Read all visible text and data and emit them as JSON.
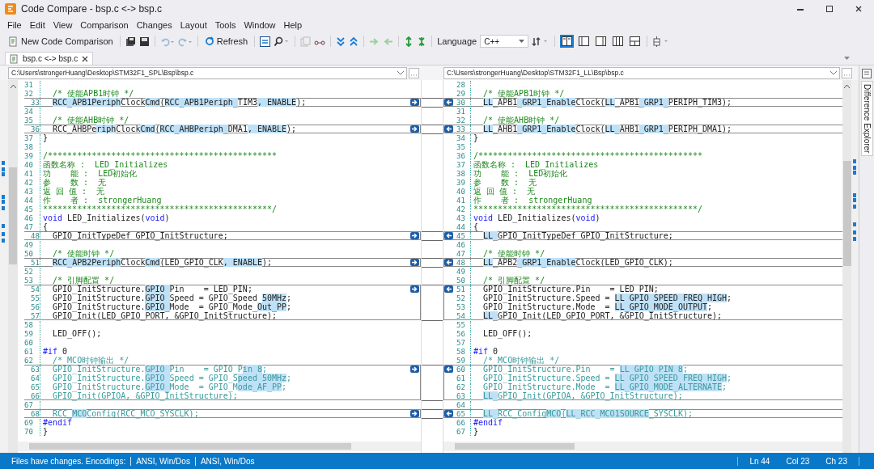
{
  "window": {
    "title": "Code Compare - bsp.c <-> bsp.c"
  },
  "menu": [
    "File",
    "Edit",
    "View",
    "Comparison",
    "Changes",
    "Layout",
    "Tools",
    "Window",
    "Help"
  ],
  "toolbar": {
    "new_comparison": "New Code Comparison",
    "refresh": "Refresh",
    "language_label": "Language",
    "language": "C++",
    "view_modes": [
      {
        "selected": true
      },
      {
        "selected": false
      },
      {
        "selected": false
      },
      {
        "selected": false
      },
      {
        "selected": false
      }
    ]
  },
  "tabs": [
    {
      "label": "bsp.c <-> bsp.c",
      "selected": true
    }
  ],
  "side_tab": "Difference Explorer",
  "left": {
    "path": "C:\\Users\\strongerHuang\\Desktop\\STM32F1_SPL\\Bsp\\bsp.c",
    "lines": [
      {
        "number": "31",
        "kind": "code",
        "changed": false,
        "arrow": false
      },
      {
        "number": "32",
        "kind": "comment",
        "changed": false,
        "arrow": false,
        "text": "  /* 使能APB1时钟 */"
      },
      {
        "number": "33",
        "kind": "code",
        "changed": true,
        "arrow": true,
        "segments": [
          {
            "text": "  RCC_APB1Periph",
            "changed": true
          },
          {
            "text": "Clock"
          },
          {
            "text": "Cmd",
            "changed": true
          },
          {
            "text": "("
          },
          {
            "text": "RCC_APB1Periph_",
            "changed": true
          },
          {
            "text": "TIM3"
          },
          {
            "text": ", ENABLE",
            "changed": true
          },
          {
            "text": ");"
          }
        ]
      },
      {
        "number": "34",
        "kind": "code",
        "changed": false,
        "arrow": false
      },
      {
        "number": "35",
        "kind": "comment",
        "changed": false,
        "arrow": false,
        "text": "  /* 使能AHB时钟 */"
      },
      {
        "number": "36",
        "kind": "code",
        "changed": true,
        "arrow": true,
        "segments": [
          {
            "text": "  RCC_AHBPe"
          },
          {
            "text": "riph",
            "changed": true
          },
          {
            "text": "Clock"
          },
          {
            "text": "Cmd",
            "changed": true
          },
          {
            "text": "("
          },
          {
            "text": "RCC_AHBPeriph_",
            "changed": true
          },
          {
            "text": "DMA1"
          },
          {
            "text": ", ENABLE",
            "changed": true
          },
          {
            "text": ");"
          }
        ]
      },
      {
        "number": "37",
        "kind": "code",
        "changed": false,
        "arrow": false,
        "text": "}"
      },
      {
        "number": "38",
        "kind": "code",
        "changed": false,
        "arrow": false
      },
      {
        "number": "39",
        "kind": "comment",
        "changed": false,
        "arrow": false,
        "text": "/***********************************************"
      },
      {
        "number": "40",
        "kind": "comment",
        "changed": false,
        "arrow": false,
        "text": "函数名称 :  LED_Initializes"
      },
      {
        "number": "41",
        "kind": "comment",
        "changed": false,
        "arrow": false,
        "text": "功    能 :  LED初始化"
      },
      {
        "number": "42",
        "kind": "comment",
        "changed": false,
        "arrow": false,
        "text": "参    数 :  无"
      },
      {
        "number": "43",
        "kind": "comment",
        "changed": false,
        "arrow": false,
        "text": "返 回 值 :  无"
      },
      {
        "number": "44",
        "kind": "comment",
        "changed": false,
        "arrow": false,
        "text": "作    者 :  strongerHuang"
      },
      {
        "number": "45",
        "kind": "comment",
        "changed": false,
        "arrow": false,
        "text": "***********************************************/"
      },
      {
        "number": "46",
        "kind": "code",
        "changed": false,
        "arrow": false,
        "segments": [
          {
            "text": "void",
            "kind": "keyword"
          },
          {
            "text": " LED_Initializes("
          },
          {
            "text": "void",
            "kind": "keyword"
          },
          {
            "text": ")"
          }
        ]
      },
      {
        "number": "47",
        "kind": "code",
        "changed": false,
        "arrow": false,
        "text": "{"
      },
      {
        "number": "48",
        "kind": "code",
        "changed": true,
        "arrow": true,
        "text": "  GPIO_InitTypeDef GPIO_InitStructure;"
      },
      {
        "number": "49",
        "kind": "code",
        "changed": false,
        "arrow": false
      },
      {
        "number": "50",
        "kind": "comment",
        "changed": false,
        "arrow": false,
        "text": "  /* 使能时钟 */"
      },
      {
        "number": "51",
        "kind": "code",
        "changed": true,
        "arrow": true,
        "segments": [
          {
            "text": "  RCC_APB2Periph",
            "changed": true
          },
          {
            "text": "Clock"
          },
          {
            "text": "Cmd",
            "changed": true
          },
          {
            "text": "(LED_GPIO_CLK"
          },
          {
            "text": ", ENABLE",
            "changed": true
          },
          {
            "text": ");"
          }
        ]
      },
      {
        "number": "52",
        "kind": "code",
        "changed": false,
        "arrow": false
      },
      {
        "number": "53",
        "kind": "comment",
        "changed": false,
        "arrow": false,
        "text": "  /* 引脚配置 */"
      },
      {
        "number": "54",
        "kind": "code",
        "changed": true,
        "arrow": true,
        "segments": [
          {
            "text": "  GPIO_InitStructure."
          },
          {
            "text": "GPIO_",
            "changed": true
          },
          {
            "text": "Pin    = LED_PIN;"
          }
        ]
      },
      {
        "number": "55",
        "kind": "code",
        "changed": true,
        "arrow": false,
        "segments": [
          {
            "text": "  GPIO_InitStructure."
          },
          {
            "text": "GPIO_",
            "changed": true
          },
          {
            "text": "Speed = GPIO_Speed_"
          },
          {
            "text": "50MHz",
            "changed": true
          },
          {
            "text": ";"
          }
        ]
      },
      {
        "number": "56",
        "kind": "code",
        "changed": true,
        "arrow": false,
        "segments": [
          {
            "text": "  GPIO_InitStructure."
          },
          {
            "text": "GPIO_",
            "changed": true
          },
          {
            "text": "Mode  = GPIO_Mode_"
          },
          {
            "text": "Out_PP",
            "changed": true
          },
          {
            "text": ";"
          }
        ]
      },
      {
        "number": "57",
        "kind": "code",
        "changed": true,
        "arrow": false,
        "text": "  GPIO_Init(LED_GPIO_PORT, &GPIO_InitStructure);"
      },
      {
        "number": "58",
        "kind": "code",
        "changed": false,
        "arrow": false
      },
      {
        "number": "59",
        "kind": "code",
        "changed": false,
        "arrow": false,
        "text": "  LED_OFF();"
      },
      {
        "number": "60",
        "kind": "code",
        "changed": false,
        "arrow": false
      },
      {
        "number": "61",
        "kind": "code",
        "changed": false,
        "arrow": false,
        "segments": [
          {
            "text": "#if",
            "kind": "keyword"
          },
          {
            "text": " 0"
          }
        ]
      },
      {
        "number": "62",
        "kind": "inactive",
        "changed": false,
        "arrow": false,
        "text": "  /* MCO时钟输出 */"
      },
      {
        "number": "63",
        "kind": "inactive",
        "changed": true,
        "arrow": true,
        "segments": [
          {
            "text": "  GPIO_InitStructure."
          },
          {
            "text": "GPIO_",
            "changed": true
          },
          {
            "text": "Pin    = GPIO_P"
          },
          {
            "text": "in_8",
            "changed": true
          },
          {
            "text": ";"
          }
        ]
      },
      {
        "number": "64",
        "kind": "inactive",
        "changed": true,
        "arrow": false,
        "segments": [
          {
            "text": "  GPIO_InitStructure."
          },
          {
            "text": "GPIO_",
            "changed": true
          },
          {
            "text": "Speed = GPIO_S"
          },
          {
            "text": "peed_50MHz",
            "changed": true
          },
          {
            "text": ";"
          }
        ]
      },
      {
        "number": "65",
        "kind": "inactive",
        "changed": true,
        "arrow": false,
        "segments": [
          {
            "text": "  GPIO_InitStructure."
          },
          {
            "text": "GPIO_",
            "changed": true
          },
          {
            "text": "Mode  = GPIO_M"
          },
          {
            "text": "ode_AF_PP",
            "changed": true
          },
          {
            "text": ";"
          }
        ]
      },
      {
        "number": "66",
        "kind": "inactive",
        "changed": true,
        "arrow": false,
        "text": "  GPIO_Init(GPIOA, &GPIO_InitStructure);"
      },
      {
        "number": "67",
        "kind": "code",
        "changed": false,
        "arrow": false
      },
      {
        "number": "68",
        "kind": "inactive",
        "changed": true,
        "arrow": true,
        "segments": [
          {
            "text": "  RCC_"
          },
          {
            "text": "MCO",
            "changed": true
          },
          {
            "text": "Config(RCC_MCO_SYSCLK);"
          }
        ]
      },
      {
        "number": "69",
        "kind": "code",
        "changed": false,
        "arrow": false,
        "segments": [
          {
            "text": "#endif",
            "kind": "keyword"
          }
        ]
      },
      {
        "number": "70",
        "kind": "code",
        "changed": false,
        "arrow": false,
        "text": "}"
      }
    ]
  },
  "right": {
    "path": "C:\\Users\\strongerHuang\\Desktop\\STM32F1_LL\\Bsp\\bsp.c",
    "lines": [
      {
        "number": "28",
        "kind": "code",
        "changed": false,
        "arrow": false
      },
      {
        "number": "29",
        "kind": "comment",
        "changed": false,
        "arrow": false,
        "text": "  /* 使能APB1时钟 */"
      },
      {
        "number": "30",
        "kind": "code",
        "changed": true,
        "arrow": true,
        "segments": [
          {
            "text": "  LL",
            "changed": true
          },
          {
            "text": "_APB1"
          },
          {
            "text": "_GRP1_Enable",
            "changed": true
          },
          {
            "text": "Clock("
          },
          {
            "text": "LL",
            "changed": true
          },
          {
            "text": "_APB1"
          },
          {
            "text": "_GRP1_",
            "changed": true
          },
          {
            "text": "PERIPH_TIM3);"
          }
        ]
      },
      {
        "number": "31",
        "kind": "code",
        "changed": false,
        "arrow": false
      },
      {
        "number": "32",
        "kind": "comment",
        "changed": false,
        "arrow": false,
        "text": "  /* 使能AHB时钟 */"
      },
      {
        "number": "33",
        "kind": "code",
        "changed": true,
        "arrow": true,
        "segments": [
          {
            "text": "  LL",
            "changed": true
          },
          {
            "text": "_AHB1"
          },
          {
            "text": "_GRP1_Enable",
            "changed": true
          },
          {
            "text": "Clock("
          },
          {
            "text": "LL_",
            "changed": true
          },
          {
            "text": "AHB1"
          },
          {
            "text": "_GRP1_",
            "changed": true
          },
          {
            "text": "PERIPH_DMA1);"
          }
        ]
      },
      {
        "number": "34",
        "kind": "code",
        "changed": false,
        "arrow": false,
        "text": "}"
      },
      {
        "number": "35",
        "kind": "code",
        "changed": false,
        "arrow": false
      },
      {
        "number": "36",
        "kind": "comment",
        "changed": false,
        "arrow": false,
        "text": "/**********************************************"
      },
      {
        "number": "37",
        "kind": "comment",
        "changed": false,
        "arrow": false,
        "text": "函数名称 :  LED_Initializes"
      },
      {
        "number": "38",
        "kind": "comment",
        "changed": false,
        "arrow": false,
        "text": "功    能 :  LED初始化"
      },
      {
        "number": "39",
        "kind": "comment",
        "changed": false,
        "arrow": false,
        "text": "参    数 :  无"
      },
      {
        "number": "40",
        "kind": "comment",
        "changed": false,
        "arrow": false,
        "text": "返 回 值 :  无"
      },
      {
        "number": "41",
        "kind": "comment",
        "changed": false,
        "arrow": false,
        "text": "作    者 :  strongerHuang"
      },
      {
        "number": "42",
        "kind": "comment",
        "changed": false,
        "arrow": false,
        "text": "**********************************************/"
      },
      {
        "number": "43",
        "kind": "code",
        "changed": false,
        "arrow": false,
        "segments": [
          {
            "text": "void",
            "kind": "keyword"
          },
          {
            "text": " LED_Initializes("
          },
          {
            "text": "void",
            "kind": "keyword"
          },
          {
            "text": ")"
          }
        ]
      },
      {
        "number": "44",
        "kind": "code",
        "changed": false,
        "arrow": false,
        "text": "{"
      },
      {
        "number": "45",
        "kind": "code",
        "changed": true,
        "arrow": true,
        "segments": [
          {
            "text": "  LL_",
            "changed": true
          },
          {
            "text": "GPIO_InitTypeDef GPIO_InitStructure;"
          }
        ]
      },
      {
        "number": "46",
        "kind": "code",
        "changed": false,
        "arrow": false
      },
      {
        "number": "47",
        "kind": "comment",
        "changed": false,
        "arrow": false,
        "text": "  /* 使能时钟 */"
      },
      {
        "number": "48",
        "kind": "code",
        "changed": true,
        "arrow": true,
        "segments": [
          {
            "text": "  LL",
            "changed": true
          },
          {
            "text": "_APB2"
          },
          {
            "text": "_GRP1_Enable",
            "changed": true
          },
          {
            "text": "Clock(LED_GPIO_CLK);"
          }
        ]
      },
      {
        "number": "49",
        "kind": "code",
        "changed": false,
        "arrow": false
      },
      {
        "number": "50",
        "kind": "comment",
        "changed": false,
        "arrow": false,
        "text": "  /* 引脚配置 */"
      },
      {
        "number": "51",
        "kind": "code",
        "changed": true,
        "arrow": true,
        "text": "  GPIO_InitStructure.Pin    = LED_PIN;"
      },
      {
        "number": "52",
        "kind": "code",
        "changed": true,
        "arrow": false,
        "segments": [
          {
            "text": "  GPIO_InitStructure.Speed = "
          },
          {
            "text": "LL_GPIO_SPEED_FREQ_HIGH",
            "changed": true
          },
          {
            "text": ";"
          }
        ]
      },
      {
        "number": "53",
        "kind": "code",
        "changed": true,
        "arrow": false,
        "segments": [
          {
            "text": "  GPIO_InitStructure.Mode  = "
          },
          {
            "text": "LL_GPIO_MODE_OUTPUT",
            "changed": true
          },
          {
            "text": ";"
          }
        ]
      },
      {
        "number": "54",
        "kind": "code",
        "changed": true,
        "arrow": false,
        "segments": [
          {
            "text": "  LL_",
            "changed": true
          },
          {
            "text": "GPIO_Init(LED_GPIO_PORT, &GPIO_InitStructure);"
          }
        ]
      },
      {
        "number": "55",
        "kind": "code",
        "changed": false,
        "arrow": false
      },
      {
        "number": "56",
        "kind": "code",
        "changed": false,
        "arrow": false,
        "text": "  LED_OFF();"
      },
      {
        "number": "57",
        "kind": "code",
        "changed": false,
        "arrow": false
      },
      {
        "number": "58",
        "kind": "code",
        "changed": false,
        "arrow": false,
        "segments": [
          {
            "text": "#if",
            "kind": "keyword"
          },
          {
            "text": " 0"
          }
        ]
      },
      {
        "number": "59",
        "kind": "inactive",
        "changed": false,
        "arrow": false,
        "text": "  /* MCO时钟输出 */"
      },
      {
        "number": "60",
        "kind": "inactive",
        "changed": true,
        "arrow": true,
        "segments": [
          {
            "text": "  GPIO_InitStructure.Pin    = "
          },
          {
            "text": "LL_GPIO_PIN_8",
            "changed": true
          },
          {
            "text": ";"
          }
        ]
      },
      {
        "number": "61",
        "kind": "inactive",
        "changed": true,
        "arrow": false,
        "segments": [
          {
            "text": "  GPIO_InitStructure.Speed = "
          },
          {
            "text": "LL_GPIO_SPEED_FREQ_HIGH",
            "changed": true
          },
          {
            "text": ";"
          }
        ]
      },
      {
        "number": "62",
        "kind": "inactive",
        "changed": true,
        "arrow": false,
        "segments": [
          {
            "text": "  GPIO_InitStructure.Mode  = "
          },
          {
            "text": "LL_GPIO_MODE_ALTERNATE",
            "changed": true
          },
          {
            "text": ";"
          }
        ]
      },
      {
        "number": "63",
        "kind": "inactive",
        "changed": true,
        "arrow": false,
        "segments": [
          {
            "text": "  LL_",
            "changed": true
          },
          {
            "text": "GPIO_Init(GPIOA, &GPIO_InitStructure);"
          }
        ]
      },
      {
        "number": "64",
        "kind": "code",
        "changed": false,
        "arrow": false
      },
      {
        "number": "65",
        "kind": "inactive",
        "changed": true,
        "arrow": true,
        "segments": [
          {
            "text": "  LL_",
            "changed": true
          },
          {
            "text": "RCC_Config"
          },
          {
            "text": "MCO",
            "changed": true
          },
          {
            "text": "("
          },
          {
            "text": "LL_RCC_MCO1SOURCE",
            "changed": true
          },
          {
            "text": "_SYSCLK);"
          }
        ]
      },
      {
        "number": "66",
        "kind": "code",
        "changed": false,
        "arrow": false,
        "segments": [
          {
            "text": "#endif",
            "kind": "keyword"
          }
        ]
      },
      {
        "number": "67",
        "kind": "code",
        "changed": false,
        "arrow": false,
        "text": "}"
      }
    ]
  },
  "status_bar": {
    "message": "Files have changes. Encodings:",
    "encodings": [
      "ANSI, Win/Dos",
      "ANSI, Win/Dos"
    ],
    "position": [
      "Ln 44",
      "Col 23",
      "Ch 23"
    ]
  }
}
